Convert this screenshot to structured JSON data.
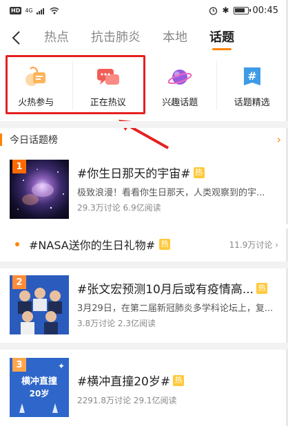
{
  "status": {
    "hd": "HD",
    "network": "4G",
    "time": "00:45"
  },
  "tabs": [
    {
      "label": "热点"
    },
    {
      "label": "抗击肺炎"
    },
    {
      "label": "本地"
    },
    {
      "label": "话题"
    }
  ],
  "active_tab": "话题",
  "icons": [
    {
      "label": "火热参与",
      "icon": "fire-icon"
    },
    {
      "label": "正在热议",
      "icon": "chat-icon"
    },
    {
      "label": "兴趣话题",
      "icon": "planet-icon"
    },
    {
      "label": "话题精选",
      "icon": "hashtag-icon"
    }
  ],
  "section": {
    "title": "今日话题榜"
  },
  "topics": [
    {
      "rank": "1",
      "title": "#你生日那天的宇宙#",
      "badge": "热",
      "desc": "极致浪漫！看看你生日那天，人类观察到的宇...",
      "stats": "29.3万讨论 6.9亿阅读"
    },
    {
      "title": "#NASA送你的生日礼物#",
      "badge": "热",
      "count": "11.9万讨论"
    },
    {
      "rank": "2",
      "title": "#张文宏预测10月后或有疫情高...",
      "badge": "热",
      "desc": "3月29日，在第二届新冠肺炎多学科论坛上，复...",
      "stats": "3.8万讨论 2.3亿阅读"
    },
    {
      "rank": "3",
      "title": "#横冲直撞20岁#",
      "badge": "热",
      "desc": "",
      "stats": "2291.8万讨论 29.1亿阅读",
      "thumb_text_1": "横冲直撞",
      "thumb_text_2": "20岁"
    }
  ],
  "colors": {
    "accent": "#ff8200",
    "highlight_box": "#e52020",
    "hot_badge": "#ffc93c"
  }
}
